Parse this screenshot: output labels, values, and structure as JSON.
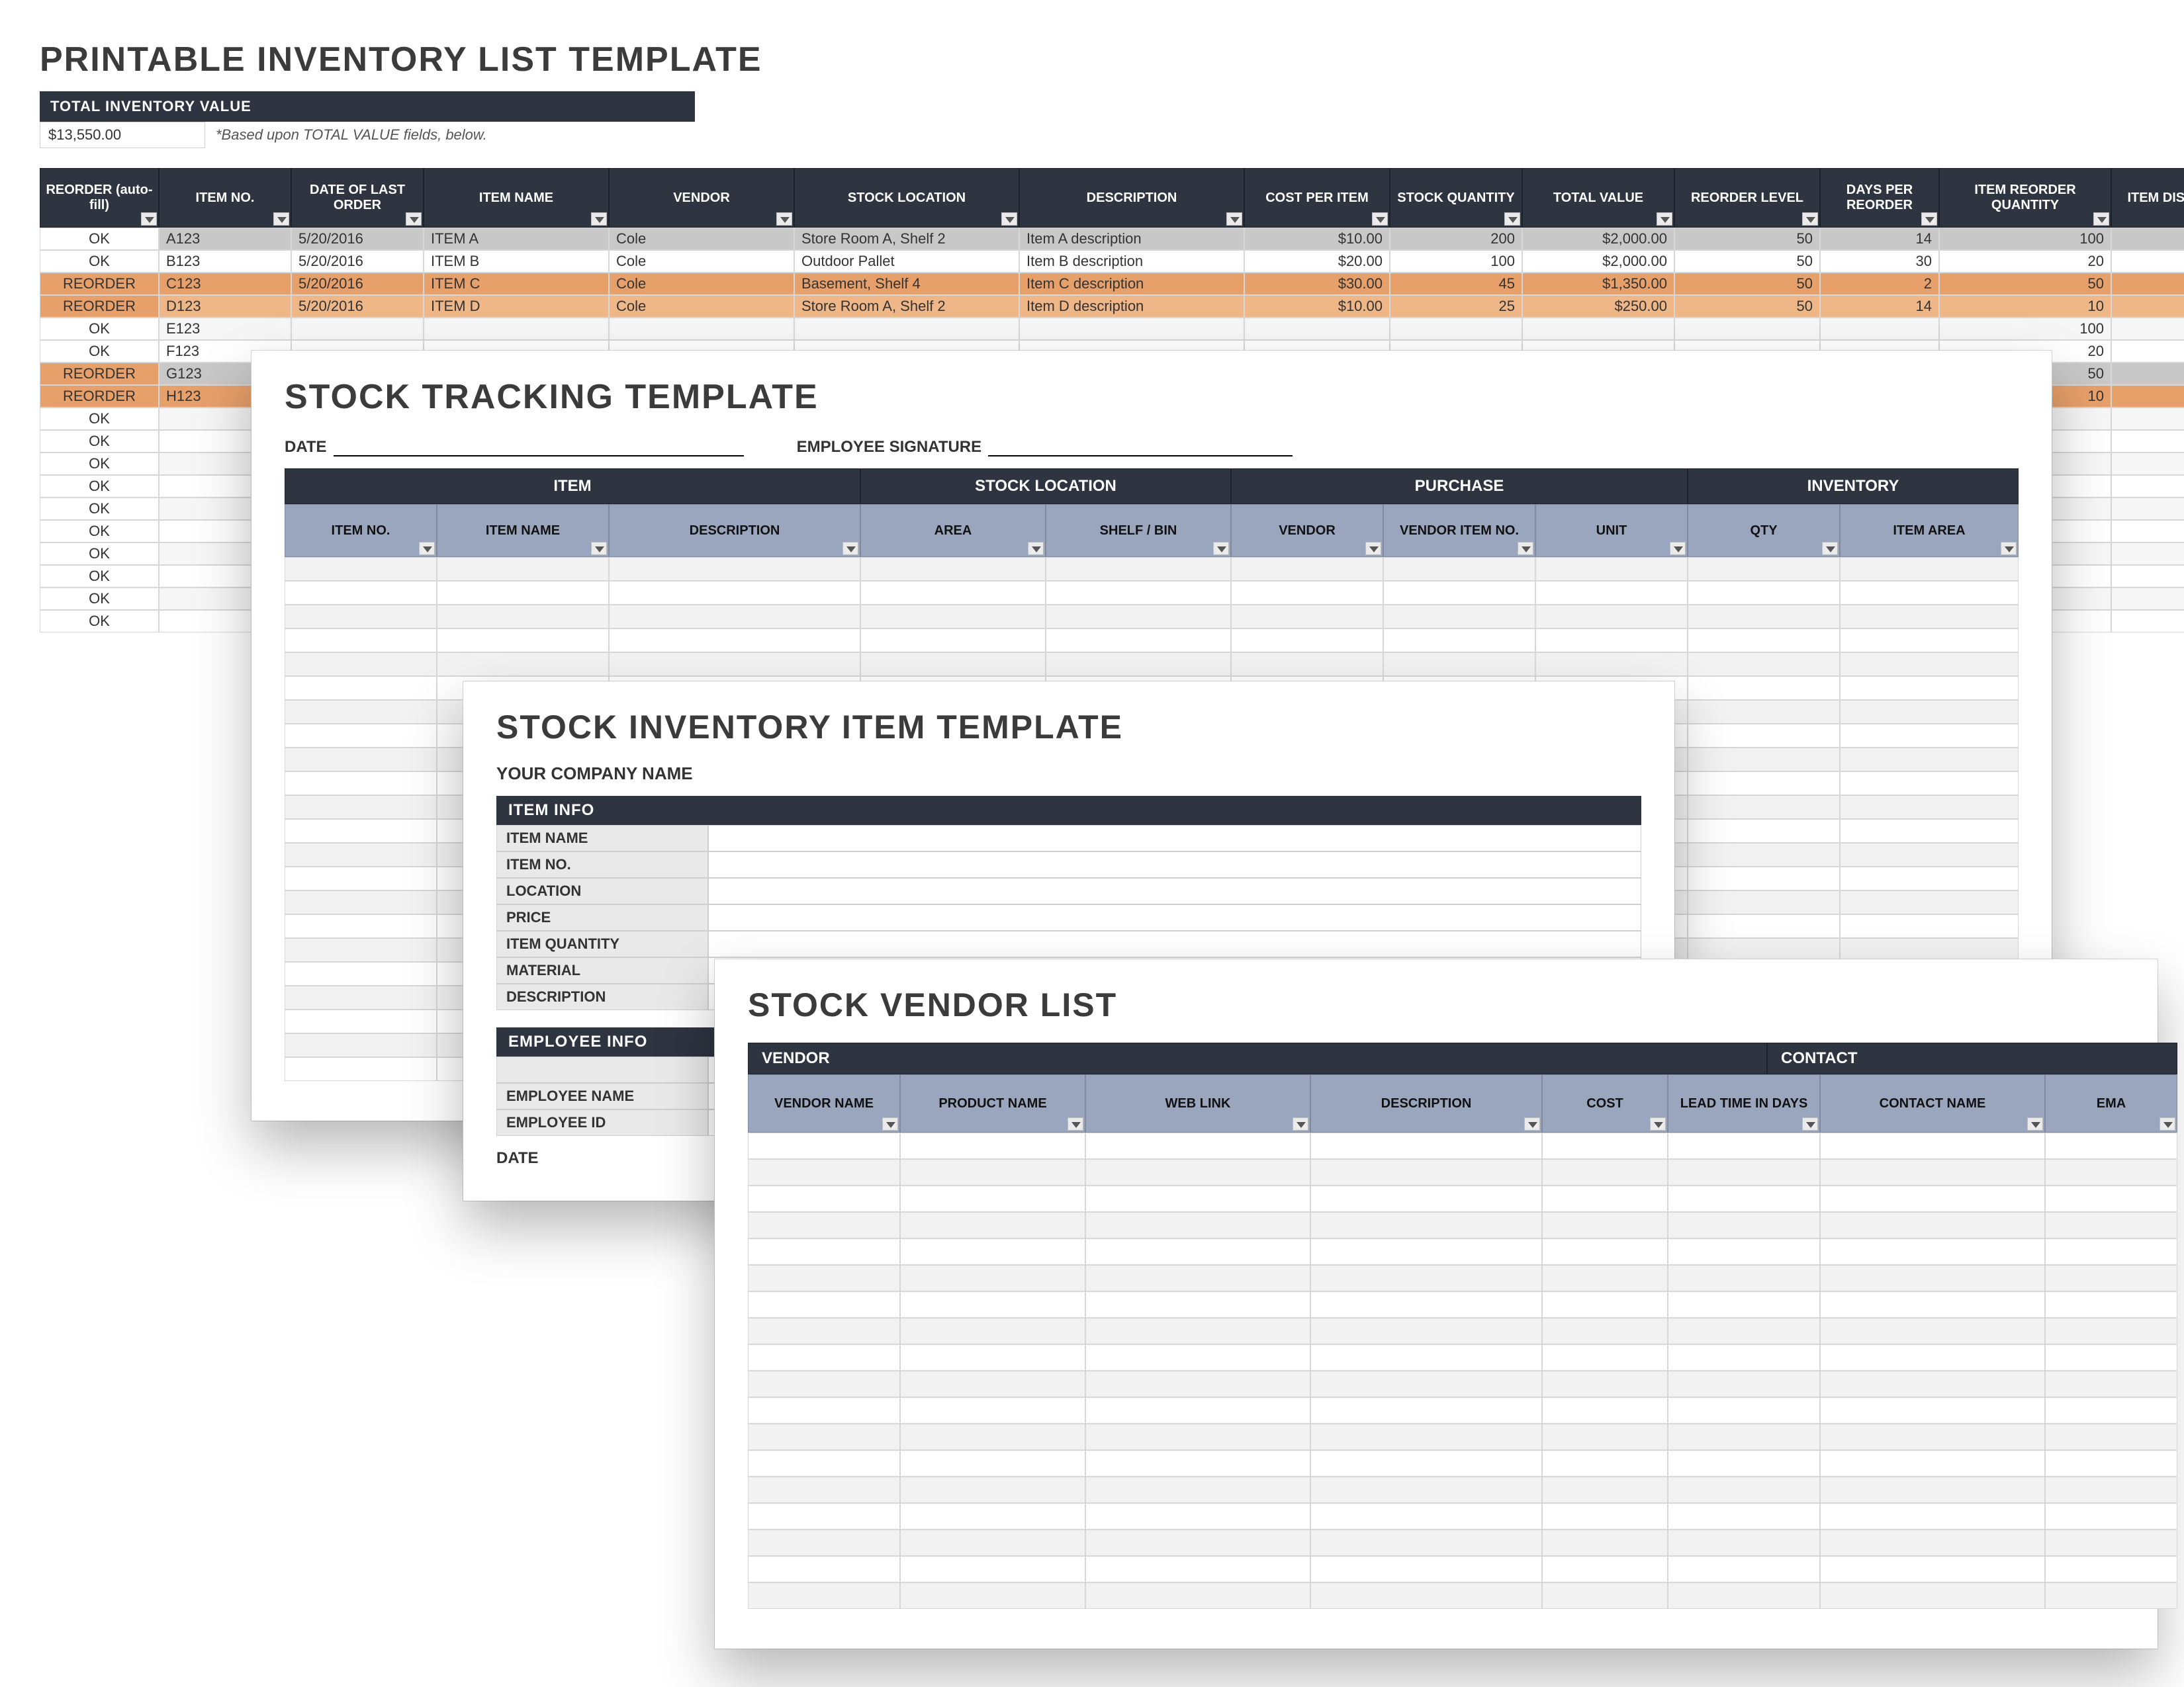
{
  "inventory": {
    "title": "PRINTABLE INVENTORY LIST TEMPLATE",
    "total_label": "TOTAL INVENTORY VALUE",
    "total_value": "$13,550.00",
    "total_note": "*Based upon TOTAL VALUE fields, below.",
    "headers": [
      "REORDER (auto-fill)",
      "ITEM NO.",
      "DATE OF LAST ORDER",
      "ITEM NAME",
      "VENDOR",
      "STOCK LOCATION",
      "DESCRIPTION",
      "COST PER ITEM",
      "STOCK QUANTITY",
      "TOTAL VALUE",
      "REORDER LEVEL",
      "DAYS PER REORDER",
      "ITEM REORDER QUANTITY",
      "ITEM DISC"
    ],
    "rows": [
      {
        "status": "OK",
        "no": "A123",
        "date": "5/20/2016",
        "name": "ITEM A",
        "vendor": "Cole",
        "loc": "Store Room A, Shelf 2",
        "desc": "Item A description",
        "cost": "$10.00",
        "qty": "200",
        "total": "$2,000.00",
        "rl": "50",
        "dpr": "14",
        "irq": "100",
        "style": "grey"
      },
      {
        "status": "OK",
        "no": "B123",
        "date": "5/20/2016",
        "name": "ITEM B",
        "vendor": "Cole",
        "loc": "Outdoor Pallet",
        "desc": "Item B description",
        "cost": "$20.00",
        "qty": "100",
        "total": "$2,000.00",
        "rl": "50",
        "dpr": "30",
        "irq": "20",
        "style": ""
      },
      {
        "status": "REORDER",
        "no": "C123",
        "date": "5/20/2016",
        "name": "ITEM C",
        "vendor": "Cole",
        "loc": "Basement, Shelf 4",
        "desc": "Item C description",
        "cost": "$30.00",
        "qty": "45",
        "total": "$1,350.00",
        "rl": "50",
        "dpr": "2",
        "irq": "50",
        "style": "orange"
      },
      {
        "status": "REORDER",
        "no": "D123",
        "date": "5/20/2016",
        "name": "ITEM D",
        "vendor": "Cole",
        "loc": "Store Room A, Shelf 2",
        "desc": "Item D description",
        "cost": "$10.00",
        "qty": "25",
        "total": "$250.00",
        "rl": "50",
        "dpr": "14",
        "irq": "10",
        "style": "fade0"
      },
      {
        "status": "OK",
        "no": "E123",
        "irq": "100",
        "style": ""
      },
      {
        "status": "OK",
        "no": "F123",
        "irq": "20",
        "style": ""
      },
      {
        "status": "REORDER",
        "no": "G123",
        "irq": "50",
        "style": "grey"
      },
      {
        "status": "REORDER",
        "no": "H123",
        "irq": "10",
        "style": "orange"
      },
      {
        "status": "OK"
      },
      {
        "status": "OK"
      },
      {
        "status": "OK"
      },
      {
        "status": "OK"
      },
      {
        "status": "OK"
      },
      {
        "status": "OK"
      },
      {
        "status": "OK"
      },
      {
        "status": "OK"
      },
      {
        "status": "OK"
      },
      {
        "status": "OK"
      }
    ]
  },
  "tracking": {
    "title": "STOCK TRACKING TEMPLATE",
    "date_label": "DATE",
    "sig_label": "EMPLOYEE SIGNATURE",
    "groups": [
      "ITEM",
      "STOCK LOCATION",
      "PURCHASE",
      "INVENTORY"
    ],
    "headers": [
      "ITEM NO.",
      "ITEM NAME",
      "DESCRIPTION",
      "AREA",
      "SHELF / BIN",
      "VENDOR",
      "VENDOR ITEM NO.",
      "UNIT",
      "QTY",
      "ITEM AREA"
    ],
    "blank_rows": 22
  },
  "item": {
    "title": "STOCK INVENTORY ITEM TEMPLATE",
    "company_label": "YOUR COMPANY NAME",
    "section1": "ITEM INFO",
    "fields1": [
      "ITEM NAME",
      "ITEM NO.",
      "LOCATION",
      "PRICE",
      "ITEM QUANTITY",
      "MATERIAL",
      "DESCRIPTION"
    ],
    "section2": "EMPLOYEE INFO",
    "fields2_blank": "",
    "fields2": [
      "EMPLOYEE NAME",
      "EMPLOYEE ID"
    ],
    "date_label": "DATE"
  },
  "vendor": {
    "title": "STOCK VENDOR LIST",
    "groups": [
      "VENDOR",
      "CONTACT"
    ],
    "headers": [
      "VENDOR NAME",
      "PRODUCT NAME",
      "WEB LINK",
      "DESCRIPTION",
      "COST",
      "LEAD TIME IN DAYS",
      "CONTACT NAME",
      "EMA"
    ],
    "blank_rows": 18
  }
}
